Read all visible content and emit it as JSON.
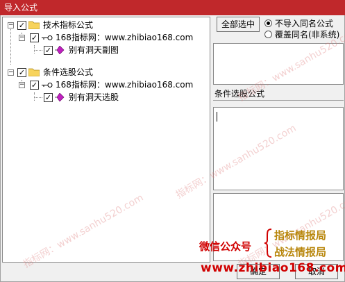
{
  "window": {
    "title": "导入公式"
  },
  "tree": {
    "nodes": [
      {
        "label": "技术指标公式",
        "checked": true
      },
      {
        "label": "168指标网：www.zhibiao168.com",
        "checked": true
      },
      {
        "label": "别有洞天副图",
        "checked": true
      },
      {
        "label": "条件选股公式",
        "checked": true
      },
      {
        "label": "168指标网：www.zhibiao168.com",
        "checked": true
      },
      {
        "label": "别有洞天选股",
        "checked": true
      }
    ]
  },
  "controls": {
    "select_all": "全部选中",
    "radio_no_import": "不导入同名公式",
    "radio_overwrite": "覆盖同名(非系统)",
    "selected_radio": "不导入同名公式"
  },
  "detail": {
    "formula_label": "条件选股公式"
  },
  "buttons": {
    "ok": "确定",
    "cancel": "取消"
  },
  "watermarks": [
    "指标网：www.sanhu520.com",
    "指标网：www.sanhu520.com",
    "指标网：www.sanhu520.com",
    "指标网：www.sanhu520.com"
  ],
  "promo": {
    "wechat": "微信公众号",
    "line1": "指标情报局",
    "line2": "战法情报局",
    "site": "www.zhibiao168.com"
  },
  "colors": {
    "title_bar": "#c0282b",
    "promo_red": "#d00000",
    "promo_gold": "#b8860b"
  }
}
